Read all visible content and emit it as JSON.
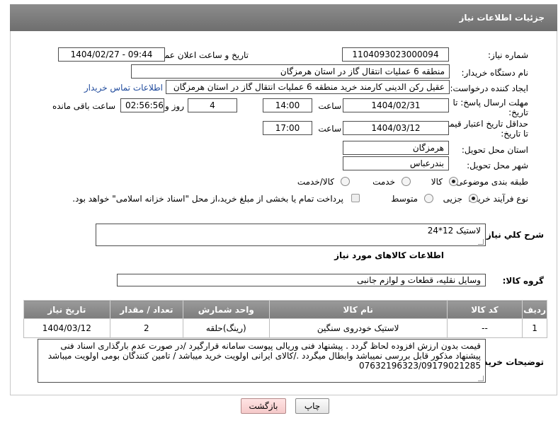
{
  "header": {
    "title": "جزئیات اطلاعات نیاز"
  },
  "fields": {
    "need_number_label": "شماره نیاز:",
    "need_number": "1104093023000094",
    "announce_label": "تاریخ و ساعت اعلان عمومی:",
    "announce_value": "1404/02/27 - 09:44",
    "buyer_org_label": "نام دستگاه خریدار:",
    "buyer_org": "منطقه 6 عملیات انتقال گاز در استان هرمزگان",
    "requester_label": "ایجاد کننده درخواست:",
    "requester": "عقیل رکن الدینی کارمند خرید منطقه 6 عملیات انتقال گاز در استان هرمزگان",
    "contact_link": "اطلاعات تماس خریدار",
    "deadline_label_1": "مهلت ارسال پاسخ: تا",
    "deadline_label_2": "تاریخ:",
    "deadline_date": "1404/02/31",
    "time_label": "ساعت",
    "deadline_time": "14:00",
    "days_value": "4",
    "days_label": "روز و",
    "remaining_time": "02:56:56",
    "remaining_label": "ساعت باقی مانده",
    "price_validity_label_1": "حداقل تاریخ اعتبار قیمت:",
    "price_validity_label_2": "تا تاریخ:",
    "price_validity_date": "1404/03/12",
    "price_validity_time_label": "ساعت",
    "price_validity_time": "17:00",
    "province_label": "استان محل تحویل:",
    "province": "هرمزگان",
    "city_label": "شهر محل تحویل:",
    "city": "بندرعباس",
    "category_label": "طبقه بندی موضوعی:",
    "category_options": [
      "کالا",
      "خدمت",
      "کالا/خدمت"
    ],
    "process_label": "نوع فرآیند خرید :",
    "process_options": [
      "جزیی",
      "متوسط"
    ],
    "payment_note": "پرداخت تمام یا بخشی از مبلغ خرید،از محل \"اسناد خزانه اسلامی\" خواهد بود."
  },
  "description": {
    "label": "شرح کلي نياز:",
    "value": "لاستیک 12*24"
  },
  "goods_section_title": "اطلاعات کالاهای مورد نیاز",
  "goods_group": {
    "label": "گروه کالا:",
    "value": "وسایل نقلیه، قطعات و لوازم جانبی"
  },
  "table": {
    "headers": [
      "ردیف",
      "کد کالا",
      "نام کالا",
      "واحد شمارش",
      "تعداد / مقدار",
      "تاریخ نیاز"
    ],
    "rows": [
      [
        "1",
        "--",
        "لاستیک خودروی سنگین",
        "(رینگ)حلقه",
        "2",
        "1404/03/12"
      ]
    ]
  },
  "buyer_notes": {
    "label": "توضیحات خریدار:",
    "value": "قیمت بدون ارزش افزوده لحاظ گردد . پیشنهاد فنی وریالی پیوست سامانه قرارگیرد /در صورت عدم بارگذاری اسناد فنی پیشنهاد مذکور قابل بررسی نمیباشد وابطال میگردد ./کالای ایرانی اولویت خرید میباشد / تامین کنندگان بومی اولویت میباشد 07632196323/09179021285"
  },
  "buttons": {
    "print": "چاپ",
    "back": "بازگشت"
  },
  "colors": {
    "header_bg": "#7d7d7d",
    "link": "#1f4a9c",
    "back_button_bg": "#f5c9c9"
  }
}
